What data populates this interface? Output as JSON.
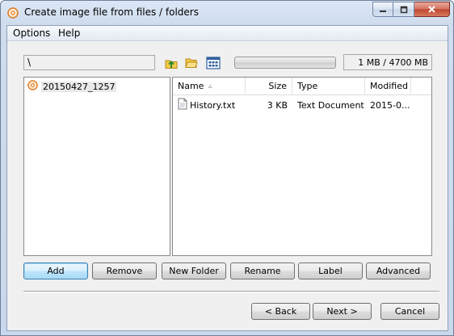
{
  "window": {
    "title": "Create image file from files / folders"
  },
  "menu": {
    "items": [
      "Options",
      "Help"
    ]
  },
  "toolbar": {
    "path": "\\",
    "icons": [
      "folder-up-icon",
      "open-folder-icon",
      "view-grid-icon"
    ],
    "progress_fraction": 0.0002,
    "size_readout": "1 MB / 4700 MB"
  },
  "tree": {
    "items": [
      {
        "label": "20150427_1257",
        "icon": "disc-icon"
      }
    ]
  },
  "file_list": {
    "columns": [
      "Name",
      "Size",
      "Type",
      "Modified"
    ],
    "sort_indicator": "▵",
    "rows": [
      {
        "name": "History.txt",
        "size": "3 KB",
        "type": "Text Document",
        "modified": "2015-0..."
      }
    ]
  },
  "actions": {
    "add": "Add",
    "remove": "Remove",
    "new_folder": "New Folder",
    "rename": "Rename",
    "label": "Label",
    "advanced": "Advanced"
  },
  "nav": {
    "back": "< Back",
    "next": "Next >",
    "cancel": "Cancel"
  },
  "colors": {
    "accent": "#3c7fb1",
    "close": "#c0432d",
    "disc_icon": "#e07a1f"
  }
}
